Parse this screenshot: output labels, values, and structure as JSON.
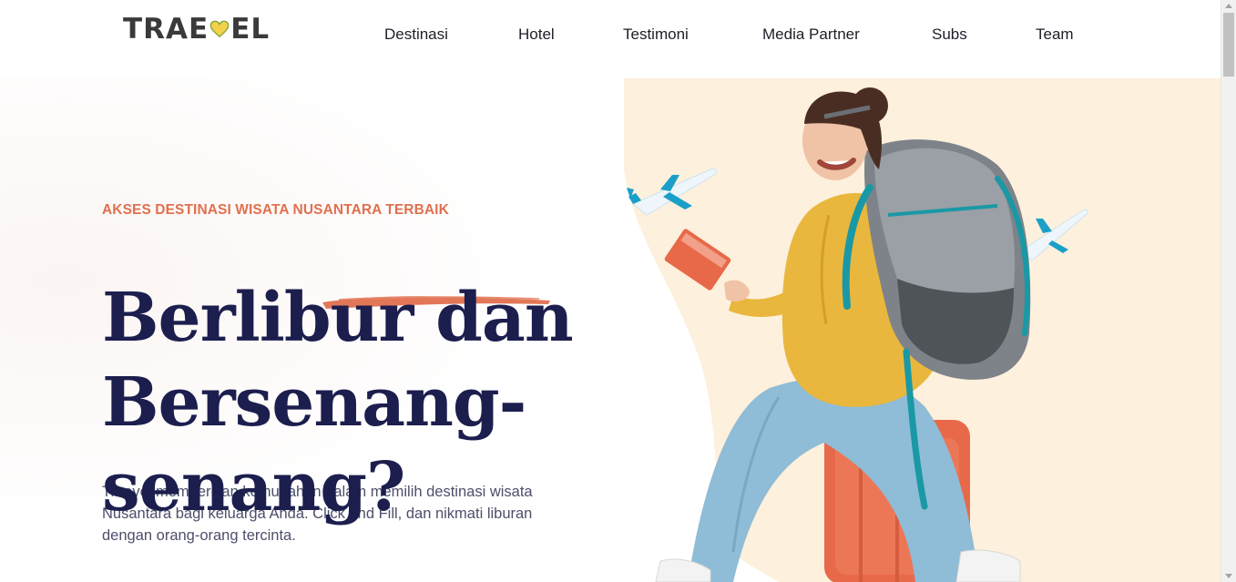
{
  "brand": {
    "logo_text_left": "TRAE",
    "logo_text_right": "EL",
    "logo_icon": "heart-icon",
    "colors": {
      "primary_navy": "#1c1e4e",
      "accent_coral": "#e0704f",
      "heart_yellow": "#f2d04a",
      "hero_cream": "#fdf0dc"
    }
  },
  "nav": {
    "items": [
      {
        "label": "Destinasi"
      },
      {
        "label": "Hotel"
      },
      {
        "label": "Testimoni"
      },
      {
        "label": "Media Partner"
      },
      {
        "label": "Subs"
      },
      {
        "label": "Team"
      }
    ]
  },
  "hero": {
    "eyebrow": "AKSES DESTINASI WISATA NUSANTARA TERBAIK",
    "headline": [
      "Berlibur dan",
      "Bersenang-",
      "senang?"
    ],
    "description": "Traevel memberikan kemudahan dalam memilih destinasi wisata Nusantara bagi keluarga Anda. Click and Fill, dan nikmati liburan dengan orang-orang tercinta."
  }
}
